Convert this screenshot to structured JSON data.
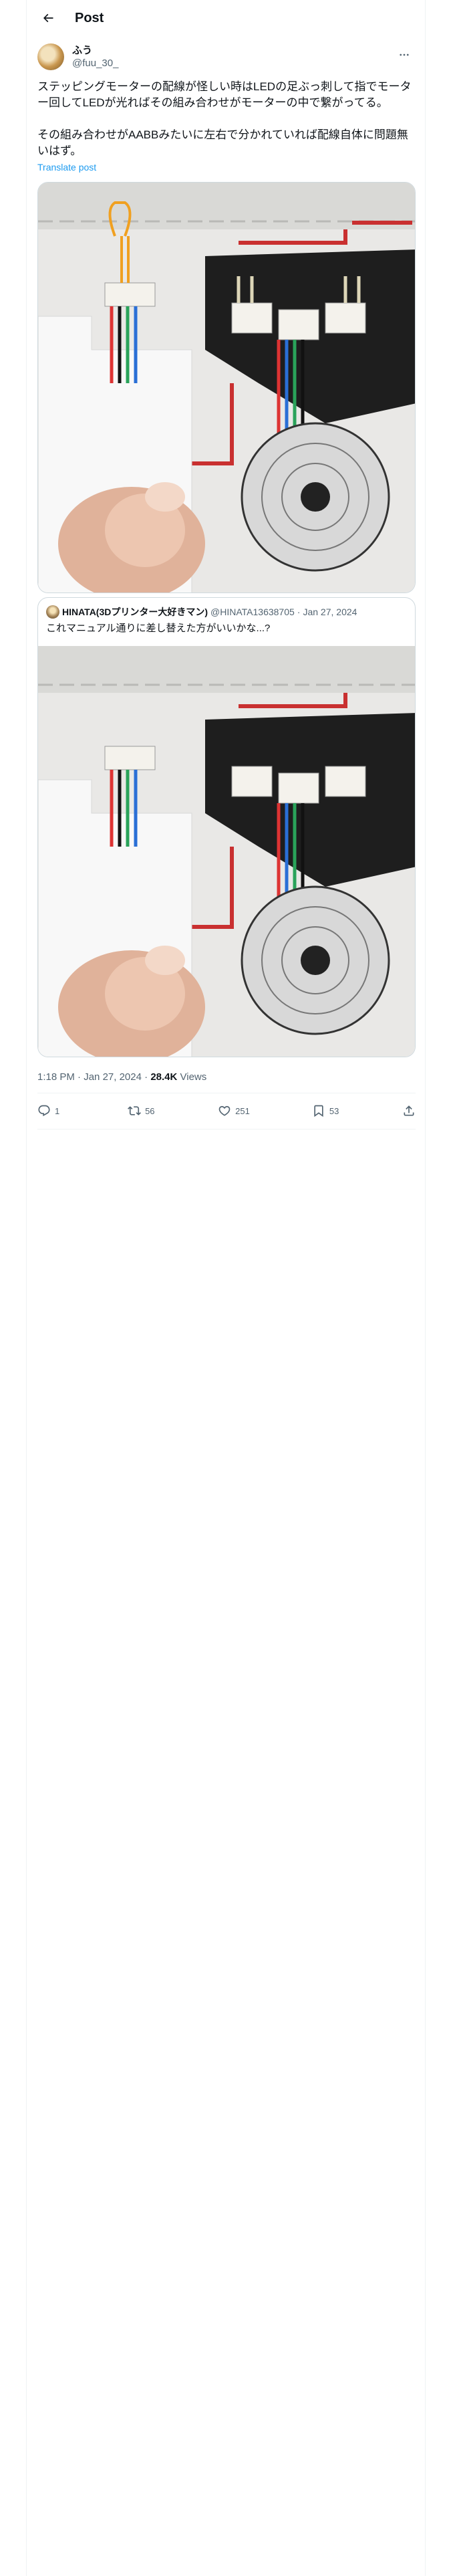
{
  "header": {
    "title": "Post",
    "back_icon": "arrow-left-icon"
  },
  "author": {
    "name": "ふう",
    "handle": "@fuu_30_"
  },
  "post": {
    "text": "ステッピングモーターの配線が怪しい時はLEDの足ぶっ刺して指でモーター回してLEDが光ればその組み合わせがモーターの中で繋がってる。\n\nその組み合わせがAABBみたいに左右で分かれていれば配線自体に問題無いはず。",
    "translate": "Translate post"
  },
  "quote": {
    "name": "HINATA(3Dプリンター大好きマン)",
    "handle": "@HINATA13638705",
    "date": "Jan 27, 2024",
    "separator": "·",
    "text": "これマニュアル通りに差し替えた方がいいかな...?"
  },
  "meta": {
    "time": "1:18 PM",
    "separator": "·",
    "date": "Jan 27, 2024",
    "views_count": "28.4K",
    "views_label": "Views"
  },
  "actions": {
    "replies": "1",
    "reposts": "56",
    "likes": "251",
    "bookmarks": "53"
  },
  "colors": {
    "link": "#1d9bf0",
    "secondary": "#536471",
    "border": "#cfd9de"
  }
}
